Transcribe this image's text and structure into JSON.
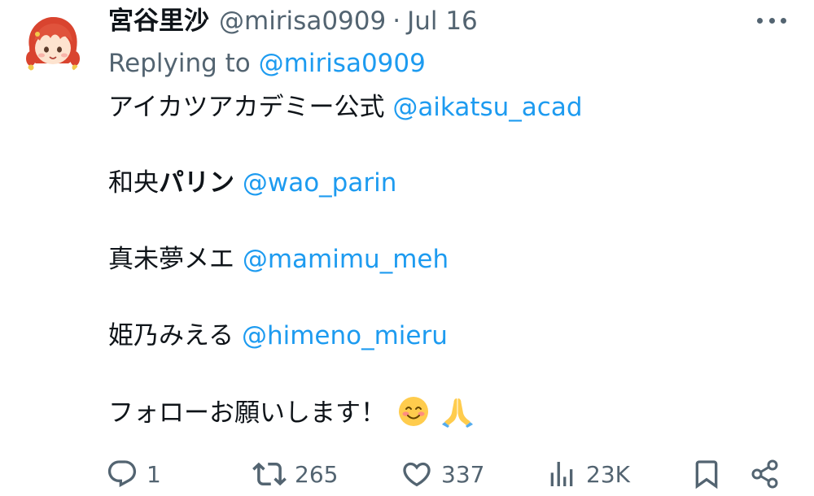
{
  "tweet": {
    "display_name": "宮谷里沙",
    "handle": "@mirisa0909",
    "separator": "·",
    "date": "Jul 16",
    "avatar_icon": "avatar-red-hair-girl-icon",
    "more_icon": "more-horizontal-icon",
    "reply_prefix": "Replying to",
    "reply_handle": "@mirisa0909",
    "lines": [
      {
        "text": "アイカツアカデミー公式",
        "mention": "@aikatsu_acad"
      },
      {
        "prefix": "和央",
        "bold": "パリン",
        "mention": "@wao_parin"
      },
      {
        "text": "真未夢メエ",
        "mention": "@mamimu_meh"
      },
      {
        "text": "姫乃みえる",
        "mention": "@himeno_mieru"
      },
      {
        "text": "フォローお願いします！",
        "emojis": [
          "smiling-face-emoji",
          "folded-hands-emoji"
        ]
      }
    ]
  },
  "actions": {
    "reply": {
      "icon": "reply-bubble-icon",
      "count": "1"
    },
    "retweet": {
      "icon": "retweet-icon",
      "count": "265"
    },
    "like": {
      "icon": "heart-icon",
      "count": "337"
    },
    "views": {
      "icon": "views-bars-icon",
      "count": "23K"
    },
    "bookmark": {
      "icon": "bookmark-icon"
    },
    "share": {
      "icon": "share-icon"
    }
  },
  "colors": {
    "link": "#1d9bf0",
    "secondary_text": "#536471",
    "primary_text": "#0f1419",
    "avatar_hair": "#d9442f"
  }
}
